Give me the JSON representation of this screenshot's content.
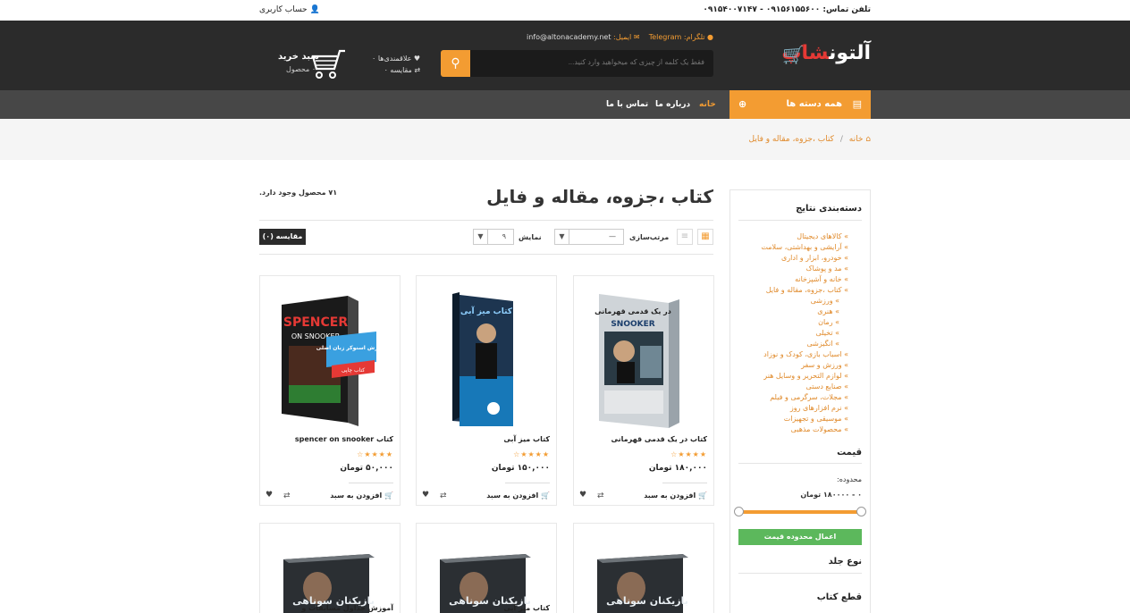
{
  "topbar": {
    "phone": "تلفن تماس: ۰۹۱۵۶۱۵۵۶۰۰ - ۰۹۱۵۴۰۰۷۱۴۷",
    "account": "حساب کاربری"
  },
  "header": {
    "logo_main": "آلتون",
    "logo_accent": "شاپ",
    "telegram_label": "تلگرام: Telegram",
    "email_label": "ایمیل:",
    "email_value": "info@altonacademy.net",
    "search_placeholder": "فقط یک کلمه از چیزی که میخواهید وارد کنید...",
    "wishlist": "علاقمندی‌ها ۰",
    "compare": "مقایسه ۰",
    "cart_title": "سبد خرید",
    "cart_count": "۰ محصول"
  },
  "nav": {
    "all_categories": "همه دسته ها",
    "home": "خانه",
    "about": "درباره ما",
    "contact": "تماس با ما"
  },
  "breadcrumb": {
    "home": "خانه",
    "current": "کتاب ،جزوه، مقاله و فایل"
  },
  "sidebar": {
    "title": "دسته‌بندی نتایج",
    "categories": [
      {
        "label": "» کالاهای دیجیتال",
        "sub": false
      },
      {
        "label": "» آرایشی و بهداشتی، سلامت",
        "sub": false
      },
      {
        "label": "» خودرو، ابزار و اداری",
        "sub": false
      },
      {
        "label": "» مد و پوشاک",
        "sub": false
      },
      {
        "label": "» خانه و آشپزخانه",
        "sub": false
      },
      {
        "label": "» کتاب ،جزوه، مقاله و فایل",
        "sub": false
      },
      {
        "label": "» ورزشی",
        "sub": true
      },
      {
        "label": "» هنری",
        "sub": true
      },
      {
        "label": "» رمان",
        "sub": true
      },
      {
        "label": "» تخیلی",
        "sub": true
      },
      {
        "label": "» انگیزشی",
        "sub": true
      },
      {
        "label": "» اسباب بازی، کودک و نوزاد",
        "sub": false
      },
      {
        "label": "» ورزش و سفر",
        "sub": false
      },
      {
        "label": "» لوازم التحریر و وسایل هنر",
        "sub": false
      },
      {
        "label": "» صنایع دستی",
        "sub": false
      },
      {
        "label": "» مجلات، سرگرمی و فیلم",
        "sub": false
      },
      {
        "label": "» نرم افزارهای روز",
        "sub": false
      },
      {
        "label": "» موسیقی و تجهیزات",
        "sub": false
      },
      {
        "label": "» محصولات مذهبی",
        "sub": false
      }
    ],
    "price_title": "قیمت",
    "range_label": "محدوده:",
    "range_value": "۰ - ۱۸۰۰۰۰ تومان",
    "range_low": 0,
    "range_high": 1,
    "apply_button": "اعمال محدوده قیمت",
    "cover_type": "نوع جلد",
    "book_size": "قطع کتاب"
  },
  "main": {
    "title": "کتاب ،جزوه، مقاله و فایل",
    "count": "۷۱ محصول وجود دارد.",
    "sort_label": "مرتب‌سازی",
    "sort_value": "—",
    "show_label": "نمایش",
    "show_value": "۹",
    "compare_button": "مقایسه (۰)",
    "products": [
      {
        "name": "کتاب در یک قدمی قهرمانی",
        "stars": "★★★★☆",
        "price": "۱۸۰,۰۰۰ تومان",
        "add": "افزودن به سبد"
      },
      {
        "name": "کتاب میز آبی",
        "stars": "★★★★☆",
        "price": "۱۵۰,۰۰۰ تومان",
        "add": "افزودن به سبد"
      },
      {
        "name": "کتاب spencer on snooker",
        "stars": "★★★★☆",
        "price": "۵۰,۰۰۰ تومان",
        "add": "افزودن به سبد"
      }
    ],
    "row2": [
      {
        "name": "کتاب بازیکنان سوناهی"
      },
      {
        "name": "کتاب میز آبی"
      },
      {
        "name": "آموزش جداول مسابقات و"
      }
    ]
  },
  "covers": {
    "c1_title": "در یک قدمی قهرمانی",
    "c1_sub": "SNOOKER",
    "c3_title": "SPENCER",
    "c3_sub": "ON SNOOKER",
    "c3_badge": "آموزش اسنوکر زبان اصلی",
    "c3_badge2": "کتاب چاپی",
    "r2_title": "بازیکنان سوناهی"
  },
  "colors": {
    "accent": "#f39c32",
    "header_bg": "#2b2b2b",
    "nav_bg": "#474747",
    "apply_green": "#5cb85c"
  }
}
